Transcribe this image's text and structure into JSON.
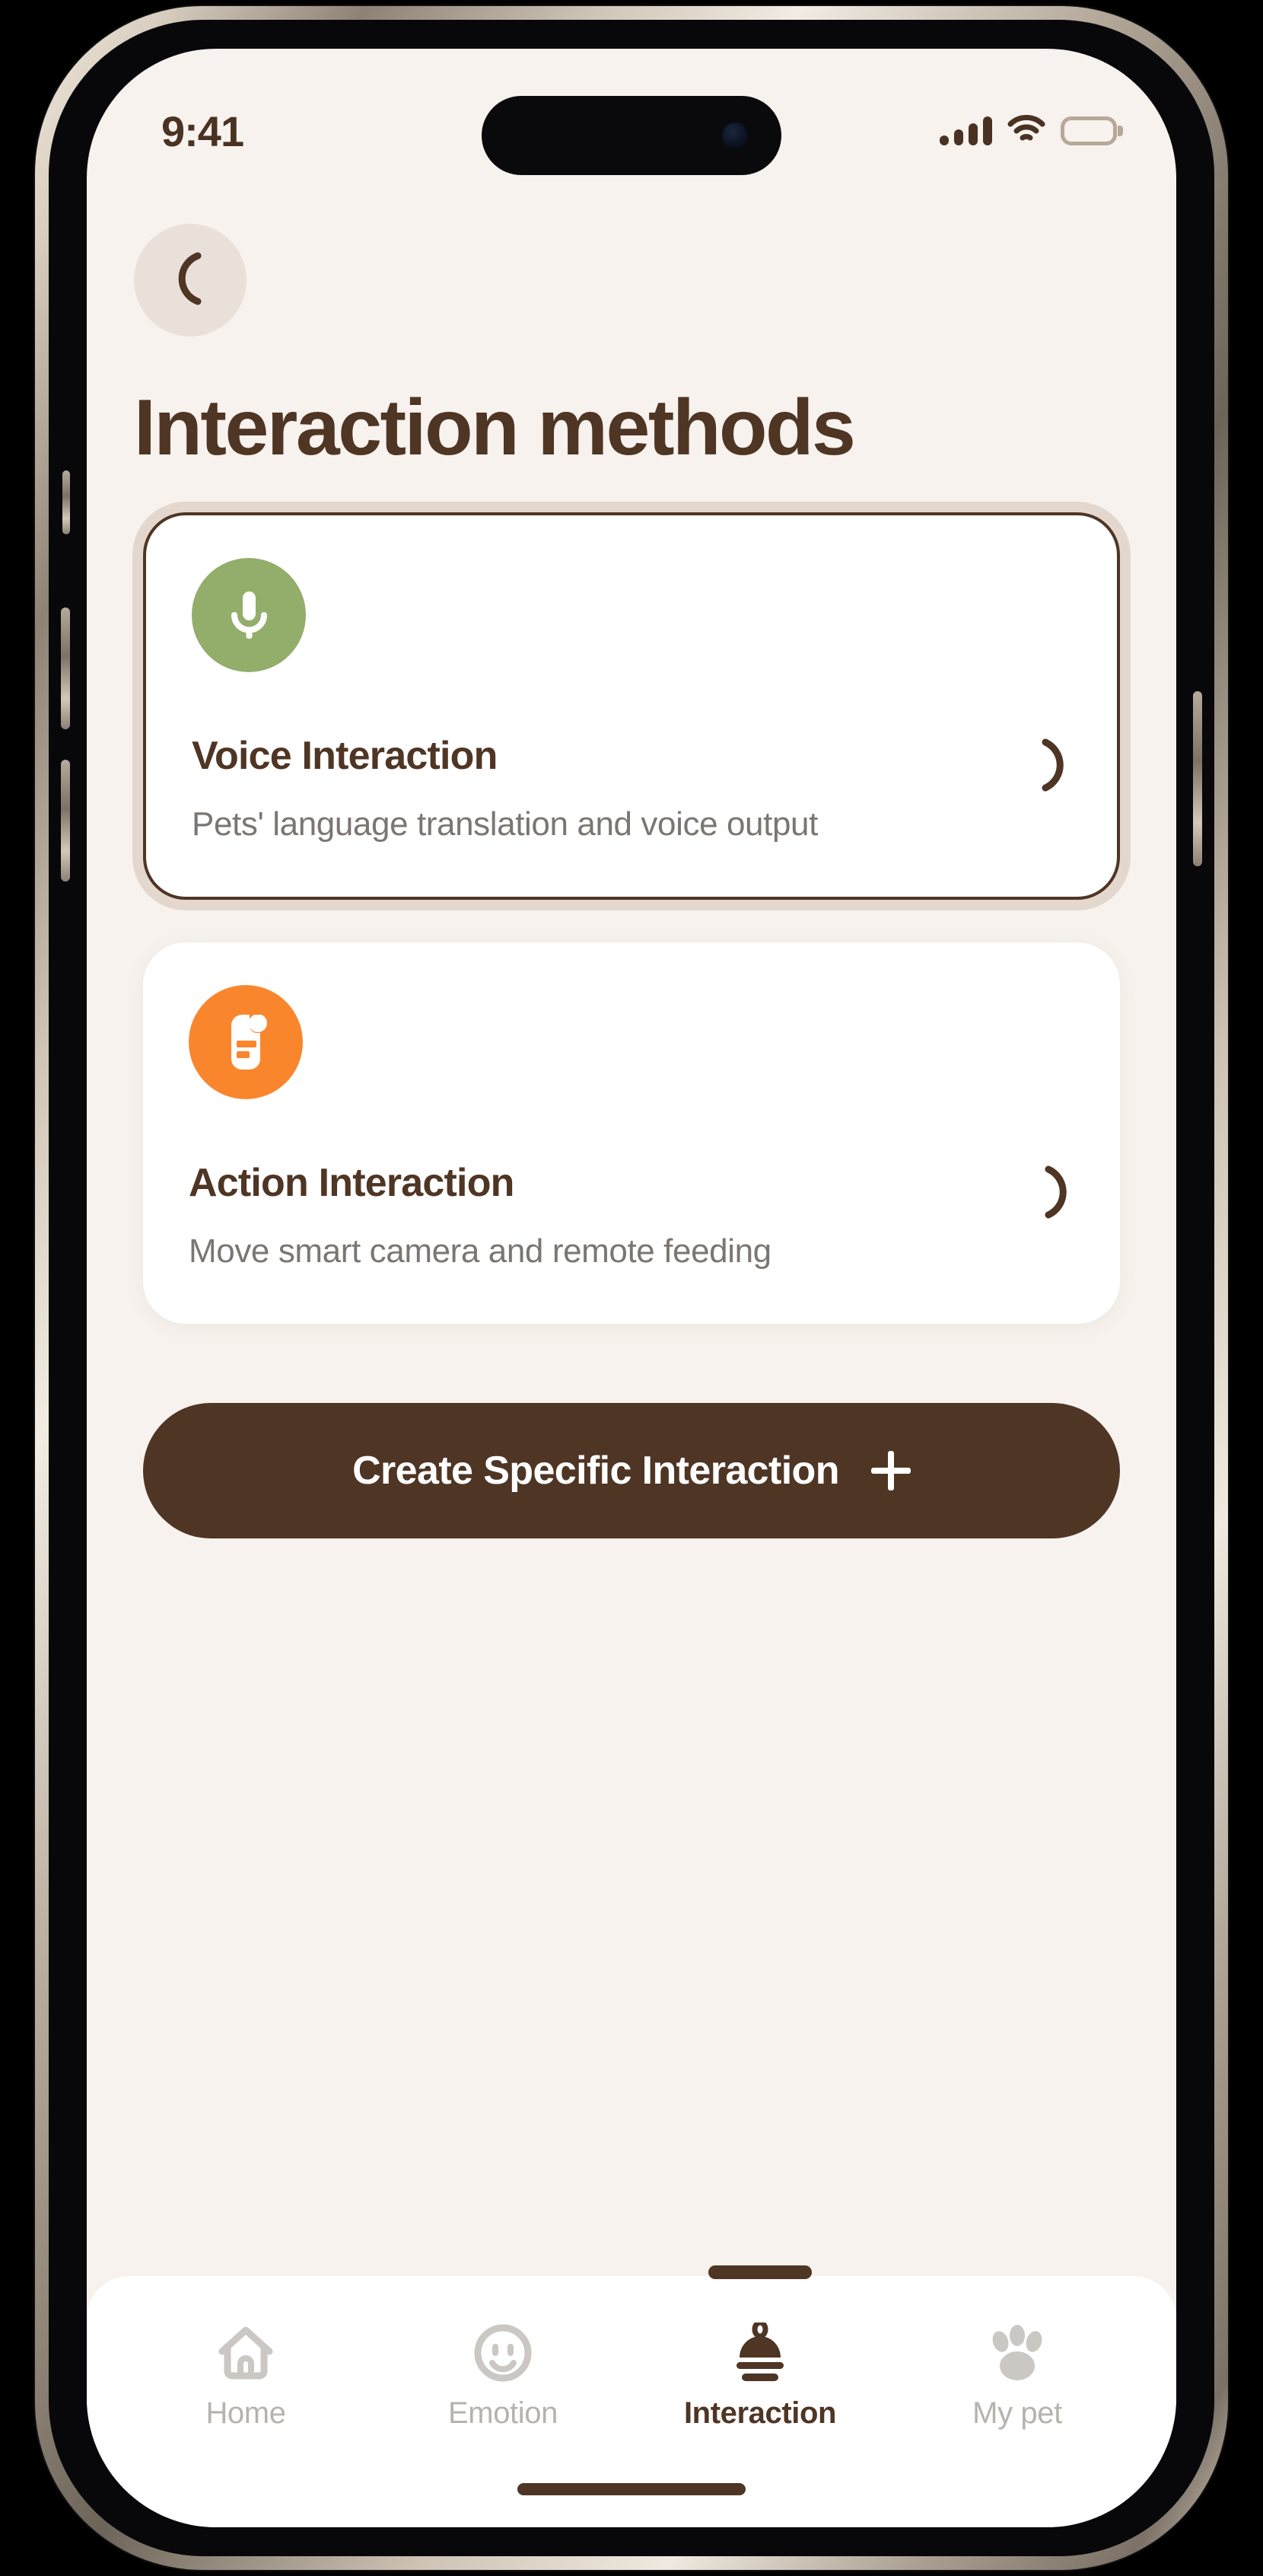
{
  "status_bar": {
    "time": "9:41",
    "signal_icon": "cellular-signal-icon",
    "wifi_icon": "wifi-icon",
    "battery_icon": "battery-icon"
  },
  "header": {
    "back_icon": "chevron-left-icon",
    "title": "Interaction methods"
  },
  "cards": [
    {
      "icon": "microphone-icon",
      "icon_color": "#93ad6b",
      "title": "Voice Interaction",
      "description": "Pets' language translation and voice output",
      "chevron_icon": "chevron-right-icon",
      "selected": true
    },
    {
      "icon": "document-icon",
      "icon_color": "#f9862d",
      "title": "Action Interaction",
      "description": "Move smart camera and remote feeding",
      "chevron_icon": "chevron-right-icon",
      "selected": false
    }
  ],
  "cta": {
    "label": "Create Specific Interaction",
    "icon": "plus-icon"
  },
  "tab_bar": {
    "items": [
      {
        "label": "Home",
        "icon": "home-icon",
        "active": false
      },
      {
        "label": "Emotion",
        "icon": "smiley-face-icon",
        "active": false
      },
      {
        "label": "Interaction",
        "icon": "bell-icon",
        "active": true
      },
      {
        "label": "My pet",
        "icon": "paw-print-icon",
        "active": false
      }
    ]
  },
  "colors": {
    "background": "#f7f2ed",
    "brand_brown": "#4f3524",
    "card_white": "#ffffff",
    "muted_text": "#7b7672",
    "selected_ring": "#e4d8ce",
    "green_accent": "#93ad6b",
    "orange_accent": "#f9862d",
    "inactive_tab": "#b7b2ad"
  }
}
